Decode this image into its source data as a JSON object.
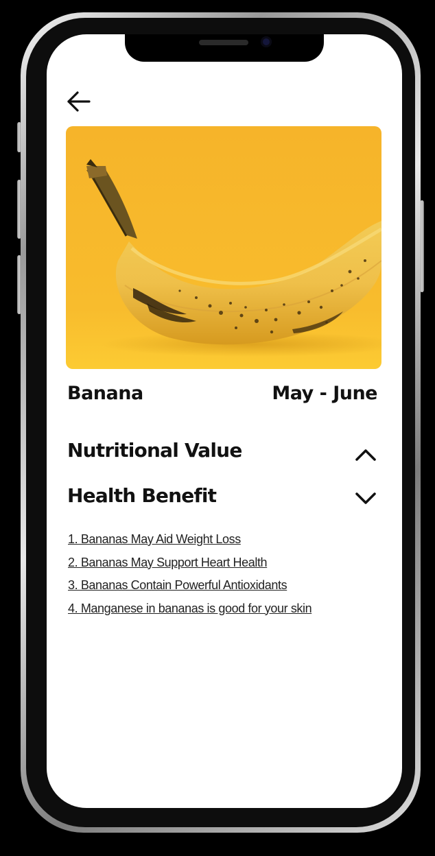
{
  "header": {
    "back_icon": "arrow-left-icon"
  },
  "hero": {
    "image_subject": "banana",
    "background_color": "#F5B72A"
  },
  "fruit": {
    "name": "Banana",
    "season": "May - June"
  },
  "sections": [
    {
      "title": "Nutritional Value",
      "icon": "chevron-up-icon",
      "expanded": false
    },
    {
      "title": "Health Benefit",
      "icon": "chevron-down-icon",
      "expanded": true
    }
  ],
  "benefits": [
    "1. Bananas May Aid Weight Loss",
    "2. Bananas May Support Heart Health",
    "3. Bananas Contain Powerful Antioxidants",
    "4. Manganese in bananas is good for your skin"
  ],
  "colors": {
    "screen": "#FFFFFF",
    "text": "#111111",
    "accent": "#F5B72A"
  }
}
